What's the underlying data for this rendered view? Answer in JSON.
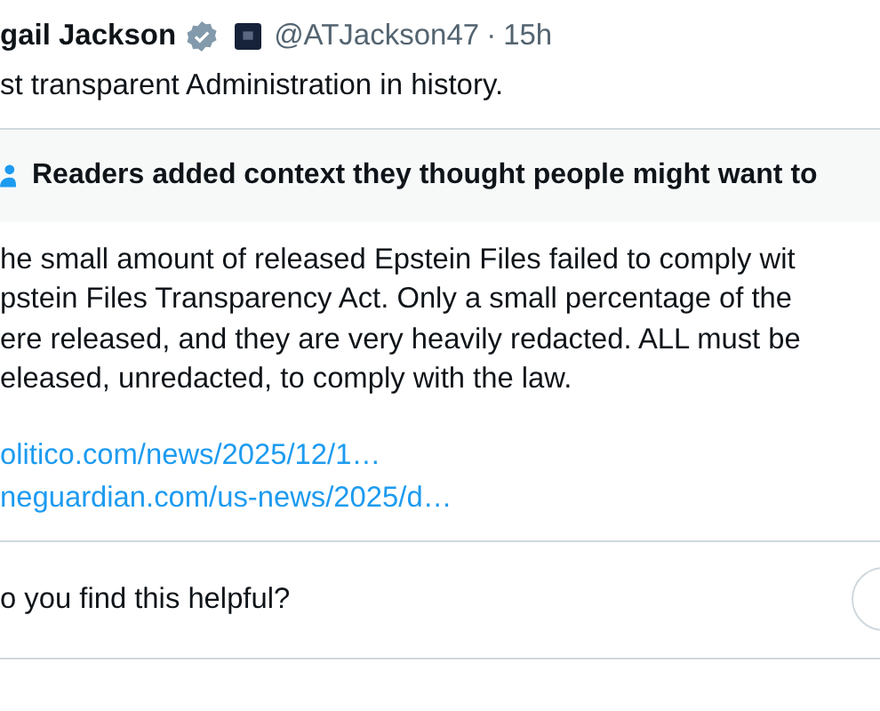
{
  "author": {
    "name": "gail Jackson",
    "verified": true,
    "handle": "@ATJackson47",
    "separator": "·",
    "time": "15h"
  },
  "post_text": "st transparent Administration in history.",
  "note": {
    "header": "Readers added context they thought people might want to",
    "lines": [
      "he small amount of released Epstein Files failed to comply wit",
      "pstein Files Transparency Act. Only a small percentage of the",
      "ere released, and they are very heavily redacted. ALL must be",
      "eleased, unredacted, to comply with the law."
    ],
    "links": [
      "olitico.com/news/2025/12/1…",
      "neguardian.com/us-news/2025/d…"
    ]
  },
  "rating": {
    "question": "o you find this helpful?"
  }
}
